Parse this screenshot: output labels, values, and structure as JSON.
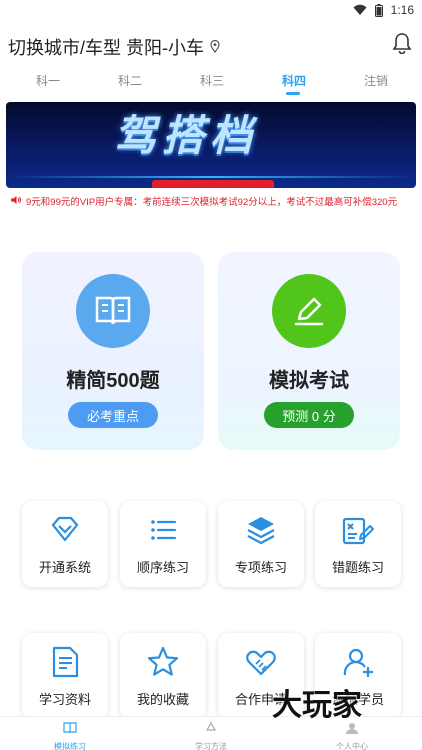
{
  "status": {
    "time": "1:16"
  },
  "header": {
    "city_text": "切换城市/车型 贵阳-小车"
  },
  "tabs": [
    {
      "label": "科一"
    },
    {
      "label": "科二"
    },
    {
      "label": "科三"
    },
    {
      "label": "科四"
    },
    {
      "label": "注销"
    }
  ],
  "banner": {
    "text": "驾搭档"
  },
  "notice": {
    "text": "9元和99元的VIP用户专属：考前连续三次模拟考试92分以上，考试不过最高可补偿320元"
  },
  "cards": {
    "left": {
      "title": "精简500题",
      "pill": "必考重点"
    },
    "right": {
      "title": "模拟考试",
      "pill": "预测 0 分"
    }
  },
  "grid": [
    {
      "label": "开通系统",
      "icon": "diamond-icon"
    },
    {
      "label": "顺序练习",
      "icon": "list-icon"
    },
    {
      "label": "专项练习",
      "icon": "layers-icon"
    },
    {
      "label": "错题练习",
      "icon": "error-note-icon"
    },
    {
      "label": "学习资料",
      "icon": "document-icon"
    },
    {
      "label": "我的收藏",
      "icon": "star-icon"
    },
    {
      "label": "合作申请",
      "icon": "handshake-icon"
    },
    {
      "label": "添加学员",
      "icon": "add-user-icon"
    }
  ],
  "bottom_nav": [
    {
      "label": "模拟练习"
    },
    {
      "label": "学习方法"
    },
    {
      "label": "个人中心"
    }
  ],
  "watermark": "大玩家",
  "colors": {
    "accent": "#2ea3f2",
    "green": "#52c51b",
    "red": "#e0202c"
  }
}
